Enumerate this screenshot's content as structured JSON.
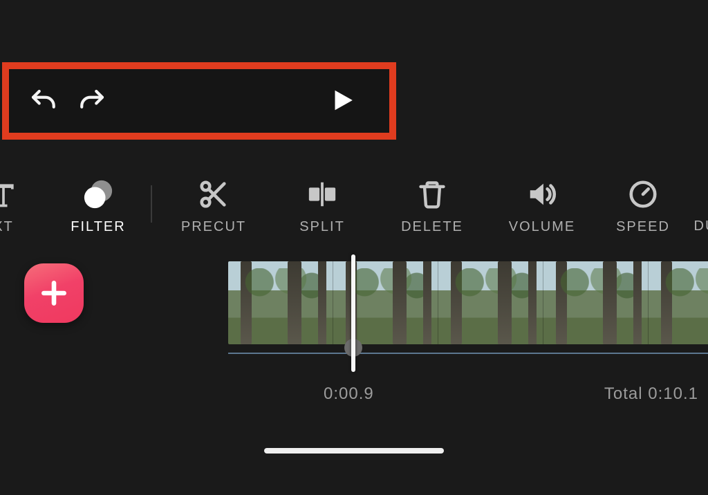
{
  "playback": {
    "undo_label": "Undo",
    "redo_label": "Redo",
    "play_label": "Play"
  },
  "toolbar": {
    "items": [
      {
        "id": "text",
        "label": "XT"
      },
      {
        "id": "filter",
        "label": "FILTER"
      },
      {
        "id": "precut",
        "label": "PRECUT"
      },
      {
        "id": "split",
        "label": "SPLIT"
      },
      {
        "id": "delete",
        "label": "DELETE"
      },
      {
        "id": "volume",
        "label": "VOLUME"
      },
      {
        "id": "speed",
        "label": "SPEED"
      },
      {
        "id": "du",
        "label": "DU"
      }
    ],
    "selected": "filter"
  },
  "add_clip_label": "Add clip",
  "timeline": {
    "current_time": "0:00.9",
    "total_label": "Total 0:10.1"
  },
  "highlight_color": "#e03c1f",
  "accent_color": "#f14168"
}
